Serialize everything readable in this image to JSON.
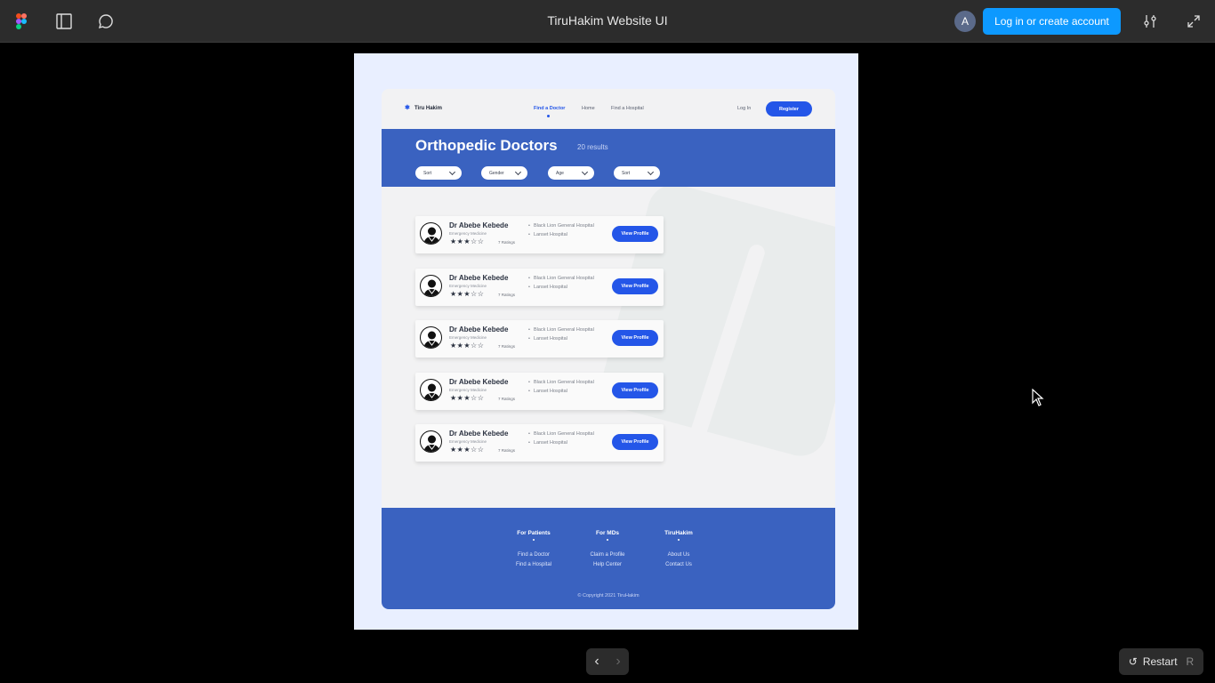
{
  "topbar": {
    "title": "TiruHakim Website UI",
    "avatar_initial": "A",
    "login_label": "Log in or create account",
    "icons": [
      "figma-logo-icon",
      "sidebar-toggle-icon",
      "comment-icon",
      "settings-sliders-icon",
      "expand-icon"
    ]
  },
  "site": {
    "logo_text": "Tiru Hakim",
    "nav": {
      "links": [
        "Find a Doctor",
        "Home",
        "Find a Hospital"
      ],
      "active": "Find a Doctor",
      "login": "Log In",
      "register": "Register"
    },
    "hero": {
      "title": "Orthopedic Doctors",
      "count": "20 results",
      "filters": [
        "Sort",
        "Gender",
        "Age",
        "Sort"
      ]
    },
    "doctors": [
      {
        "name": "Dr Abebe Kebede",
        "specialty": "Emergency Medicine",
        "rating_stars": 3,
        "ratings": "7 Ratings",
        "hospitals": [
          "Black Lion General Hospital",
          "Lanset Hospital"
        ],
        "button": "View Profile"
      },
      {
        "name": "Dr Abebe Kebede",
        "specialty": "Emergency Medicine",
        "rating_stars": 3,
        "ratings": "7 Ratings",
        "hospitals": [
          "Black Lion General Hospital",
          "Lanset Hospital"
        ],
        "button": "View Profile"
      },
      {
        "name": "Dr Abebe Kebede",
        "specialty": "Emergency Medicine",
        "rating_stars": 3,
        "ratings": "7 Ratings",
        "hospitals": [
          "Black Lion General Hospital",
          "Lanset Hospital"
        ],
        "button": "View Profile"
      },
      {
        "name": "Dr Abebe Kebede",
        "specialty": "Emergency Medicine",
        "rating_stars": 3,
        "ratings": "7 Ratings",
        "hospitals": [
          "Black Lion General Hospital",
          "Lanset Hospital"
        ],
        "button": "View Profile"
      },
      {
        "name": "Dr Abebe Kebede",
        "specialty": "Emergency Medicine",
        "rating_stars": 3,
        "ratings": "7 Ratings",
        "hospitals": [
          "Black Lion General Hospital",
          "Lanset Hospital"
        ],
        "button": "View Profile"
      }
    ],
    "footer": {
      "columns": [
        {
          "heading": "For Patients",
          "links": [
            "Find a Doctor",
            "Find a Hospital"
          ]
        },
        {
          "heading": "For MDs",
          "links": [
            "Claim a Profile",
            "Help Center"
          ]
        },
        {
          "heading": "TiruHakim",
          "links": [
            "About Us",
            "Contact Us"
          ]
        }
      ],
      "copyright": "© Copyright 2021 TiruHakim"
    }
  },
  "controls": {
    "prev": "‹",
    "next": "›",
    "restart_label": "Restart",
    "restart_key": "R"
  },
  "colors": {
    "figma_bar": "#2c2c2c",
    "figma_blue": "#0d99ff",
    "brand_blue": "#2456e8",
    "hero_blue": "#3a62c0",
    "frame_bg": "#e9efff"
  }
}
